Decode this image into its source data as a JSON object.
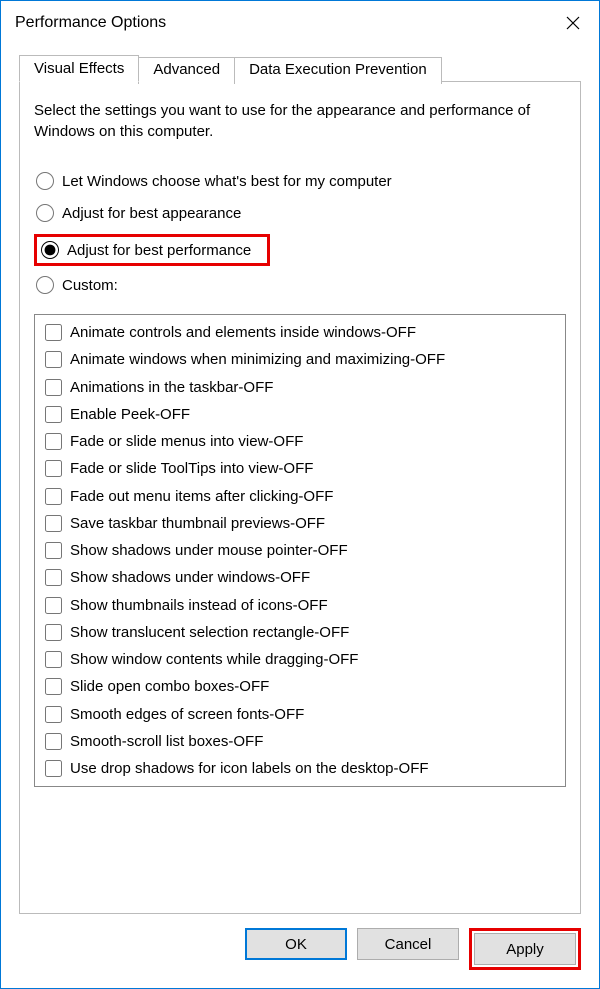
{
  "window": {
    "title": "Performance Options"
  },
  "tabs": {
    "visual_effects": "Visual Effects",
    "advanced": "Advanced",
    "dep": "Data Execution Prevention"
  },
  "intro": "Select the settings you want to use for the appearance and performance of Windows on this computer.",
  "radios": {
    "let_windows": "Let Windows choose what's best for my computer",
    "best_appearance": "Adjust for best appearance",
    "best_performance": "Adjust for best performance",
    "custom": "Custom:"
  },
  "options": [
    "Animate controls and elements inside windows-OFF",
    "Animate windows when minimizing and maximizing-OFF",
    "Animations in the taskbar-OFF",
    "Enable Peek-OFF",
    "Fade or slide menus into view-OFF",
    "Fade or slide ToolTips into view-OFF",
    "Fade out menu items after clicking-OFF",
    "Save taskbar thumbnail previews-OFF",
    "Show shadows under mouse pointer-OFF",
    "Show shadows under windows-OFF",
    "Show thumbnails instead of icons-OFF",
    "Show translucent selection rectangle-OFF",
    "Show window contents while dragging-OFF",
    "Slide open combo boxes-OFF",
    "Smooth edges of screen fonts-OFF",
    "Smooth-scroll list boxes-OFF",
    "Use drop shadows for icon labels on the desktop-OFF"
  ],
  "buttons": {
    "ok": "OK",
    "cancel": "Cancel",
    "apply": "Apply"
  }
}
